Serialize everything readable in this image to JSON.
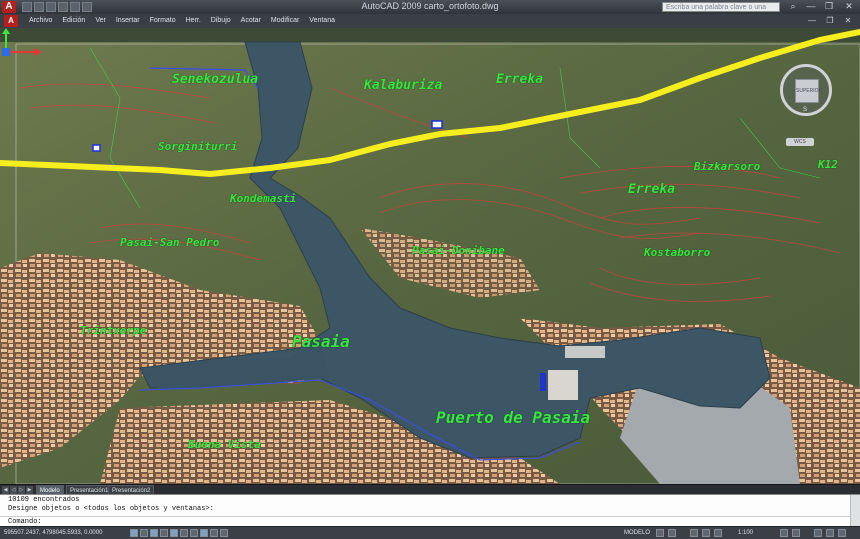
{
  "window": {
    "title": "AutoCAD 2009  carto_ortofoto.dwg",
    "search_placeholder": "Escriba una palabra clave o una frase",
    "logo_letter": "A",
    "controls": [
      "—",
      "❐",
      "✕"
    ]
  },
  "menubar": {
    "items": [
      "Archivo",
      "Edición",
      "Ver",
      "Insertar",
      "Formato",
      "Herr.",
      "Dibujo",
      "Acotar",
      "Modificar",
      "Ventana"
    ],
    "controls": [
      "—",
      "❐",
      "✕"
    ]
  },
  "drawing": {
    "place_names": {
      "senekozulua": "Senekozulua",
      "kalaburiza": "Kalaburiza",
      "erreka_top": "Erreka",
      "sorginiturri": "Sorginiturri",
      "bizkarsoro": "Bizkarsoro",
      "k12": "K12",
      "kondemasti": "Kondemasti",
      "erreka_mid": "Erreka",
      "pasai_san_pedro": "Pasai-San Pedro",
      "pasai_donibane": "Pasai-Donibane",
      "kostaborro": "Kostaborro",
      "trintxerpe": "Trintxerpe",
      "pasaia": "Pasaia",
      "puerto_de_pasaia": "Puerto de Pasaia",
      "buena_vista": "Buena Vista"
    },
    "viewcube_face": "SUPERIOR",
    "viewcube_compass": "S",
    "wcs_label": "WCS",
    "ucs_axes": [
      "Y",
      "X"
    ],
    "colors": {
      "road_line": "#f7ee1e",
      "labels": "#35e83d",
      "water": "#3c5666",
      "contours": "#d24040"
    }
  },
  "tabs": {
    "items": [
      "Modelo",
      "Presentación1",
      "Presentación2"
    ],
    "active": "Modelo"
  },
  "command": {
    "line1": "10109 encontrados",
    "line2": "Designe objetos o <todos los objetos y ventanas>:",
    "prompt": "Comando:"
  },
  "status": {
    "coordinates": "595507.2437, 4798045.5933, 0.0000",
    "mode": "MODELO",
    "scale": "1:100"
  }
}
